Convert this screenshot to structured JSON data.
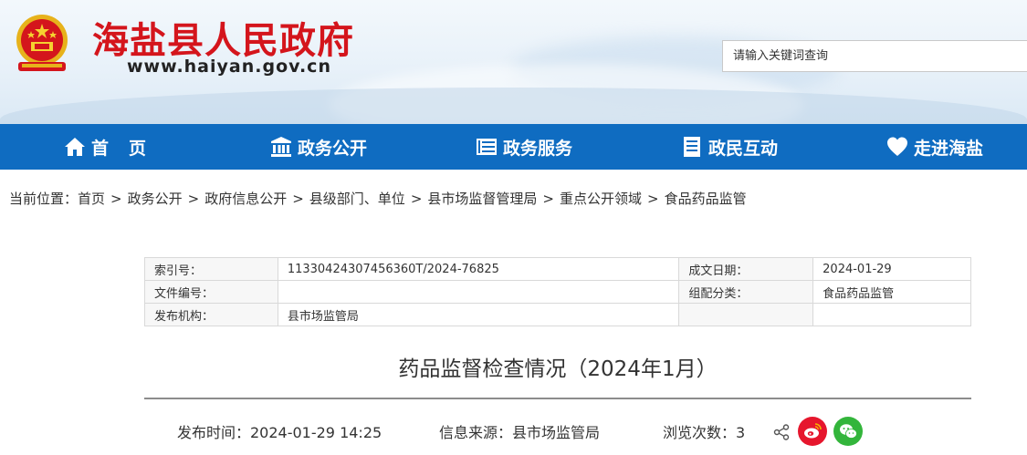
{
  "header": {
    "site_title": "海盐县人民政府",
    "site_url": "www.haiyan.gov.cn",
    "search_placeholder": "请输入关键词查询"
  },
  "nav": {
    "items": [
      {
        "label": "首页",
        "icon": "home-icon"
      },
      {
        "label": "政务公开",
        "icon": "building-icon"
      },
      {
        "label": "政务服务",
        "icon": "document-list-icon"
      },
      {
        "label": "政民互动",
        "icon": "notepad-icon"
      },
      {
        "label": "走进海盐",
        "icon": "heart-icon"
      }
    ]
  },
  "breadcrumb": {
    "prefix": "当前位置：",
    "items": [
      "首页",
      "政务公开",
      "政府信息公开",
      "县级部门、单位",
      "县市场监督管理局",
      "重点公开领域",
      "食品药品监管"
    ],
    "separator": ">"
  },
  "info": {
    "index_key": "索引号：",
    "index_val": "11330424307456360T/2024-76825",
    "date_key": "成文日期：",
    "date_val": "2024-01-29",
    "docno_key": "文件编号：",
    "docno_val": "",
    "category_key": "组配分类：",
    "category_val": "食品药品监管",
    "org_key": "发布机构：",
    "org_val": "县市场监管局"
  },
  "article": {
    "title": "药品监督检查情况（2024年1月）",
    "publish_time": "发布时间：2024-01-29 14:25",
    "source": "信息来源：县市场监管局",
    "views": "浏览次数：3"
  },
  "colors": {
    "brand_red": "#d4151c",
    "nav_blue": "#0f6cc1",
    "weibo_red": "#e6162d",
    "wechat_green": "#33b53b"
  }
}
